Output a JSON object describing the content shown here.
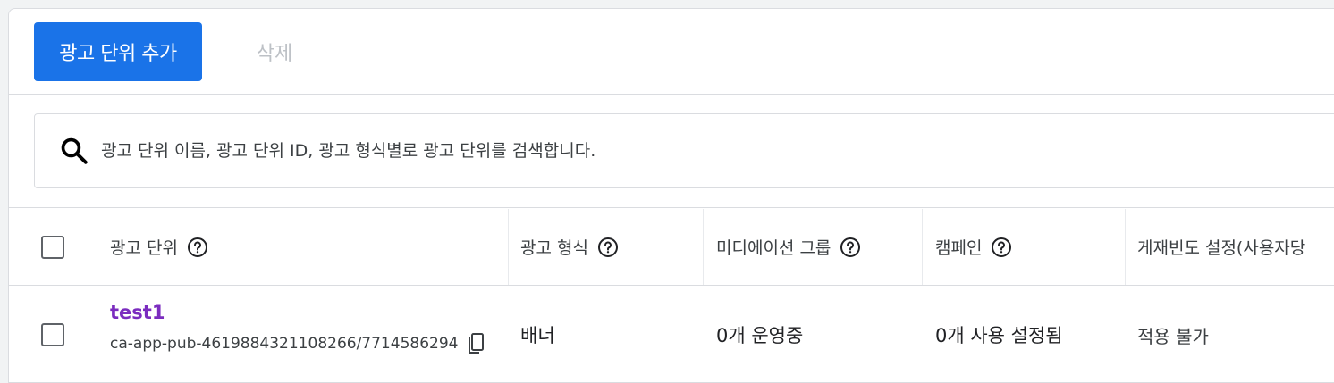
{
  "toolbar": {
    "add_label": "광고 단위 추가",
    "delete_label": "삭제"
  },
  "search": {
    "placeholder": "광고 단위 이름, 광고 단위 ID, 광고 형식별로 광고 단위를 검색합니다.",
    "icon": "search-icon"
  },
  "table": {
    "columns": [
      {
        "label": "광고 단위",
        "help_icon": "help-circle-icon"
      },
      {
        "label": "광고 형식",
        "help_icon": "help-circle-icon"
      },
      {
        "label": "미디에이션 그룹",
        "help_icon": "help-circle-icon"
      },
      {
        "label": "캠페인",
        "help_icon": "help-circle-icon"
      },
      {
        "label": "게재빈도 설정(사용자당"
      }
    ],
    "rows": [
      {
        "name": "test1",
        "id": "ca-app-pub-4619884321108266/7714586294",
        "format": "배너",
        "mediation": "0개 운영중",
        "campaigns": "0개 사용 설정됨",
        "frequency": "적용 불가"
      }
    ]
  },
  "colors": {
    "primary": "#1a73e8",
    "link": "#7b2cbf",
    "border": "#dadce0",
    "disabled": "#bdc1c6"
  }
}
